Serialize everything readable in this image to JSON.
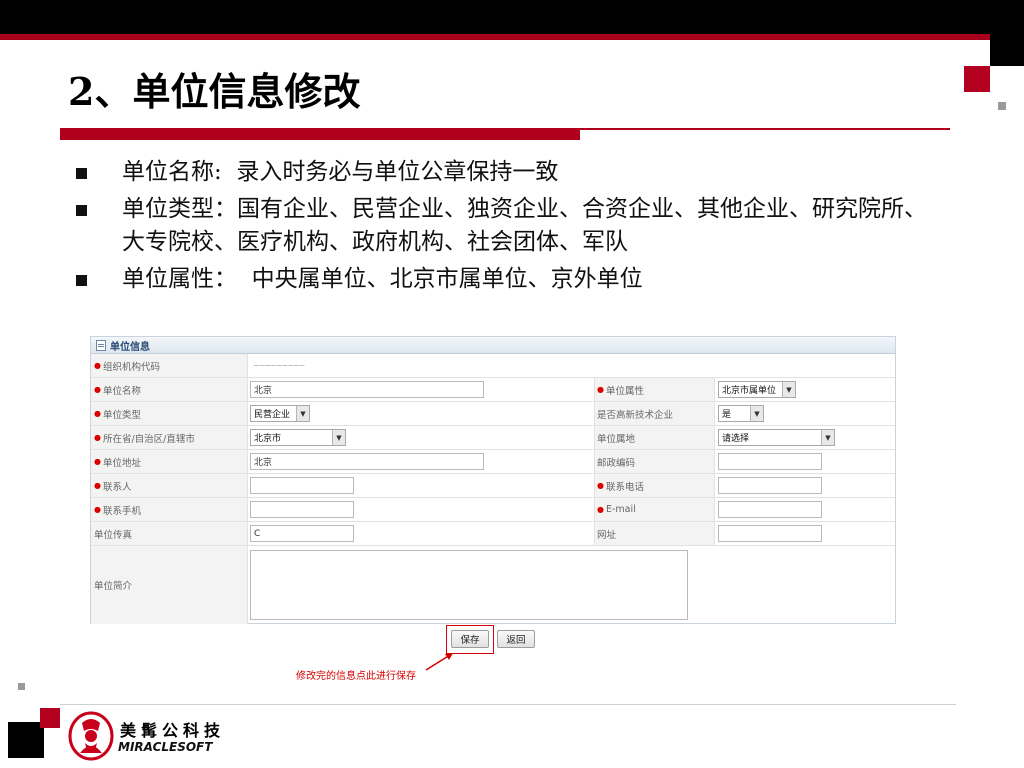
{
  "slide": {
    "title": "2、单位信息修改",
    "bullets": [
      {
        "label": "单位名称:  ",
        "text": "录入时务必与单位公章保持一致"
      },
      {
        "label": "单位类型：",
        "text": "国有企业、民营企业、独资企业、合资企业、其他企业、研究院所、大专院校、医疗机构、政府机构、社会团体、军队"
      },
      {
        "label": "单位属性：  ",
        "text": "中央属单位、北京市属单位、京外单位"
      }
    ]
  },
  "form": {
    "panel_title": "单位信息",
    "labels": {
      "org_code": "组织机构代码",
      "unit_name": "单位名称",
      "unit_attr": "单位属性",
      "unit_type": "单位类型",
      "high_tech": "是否高新技术企业",
      "region": "所在省/自治区/直辖市",
      "unit_location": "单位属地",
      "address": "单位地址",
      "postcode": "邮政编码",
      "contact": "联系人",
      "contact_phone": "联系电话",
      "mobile": "联系手机",
      "email": "E-mail",
      "fax": "单位传真",
      "website": "网址",
      "intro": "单位简介"
    },
    "values": {
      "unit_name": "北京",
      "unit_attr": "北京市属单位",
      "unit_type": "民营企业",
      "high_tech": "是",
      "region": "北京市",
      "unit_location": "请选择",
      "address": "北京",
      "postcode": "",
      "contact": "",
      "contact_phone": "",
      "mobile": "",
      "email": "",
      "fax": "C",
      "website": "",
      "intro": ""
    },
    "buttons": {
      "save": "保存",
      "back": "返回"
    },
    "annotation": "修改完的信息点此进行保存"
  },
  "footer": {
    "logo_cn": "美髯公科技",
    "logo_en": "MIRACLESOFT"
  },
  "colors": {
    "brand_red": "#b0001c",
    "required_star": "#dd0000",
    "annotation_red": "#d40000"
  }
}
